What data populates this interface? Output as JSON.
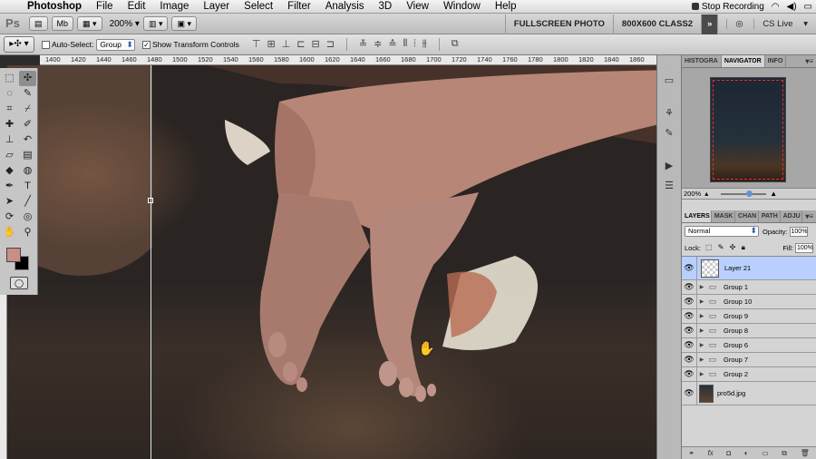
{
  "menubar": {
    "app_name": "Photoshop",
    "items": [
      "File",
      "Edit",
      "Image",
      "Layer",
      "Select",
      "Filter",
      "Analysis",
      "3D",
      "View",
      "Window",
      "Help"
    ],
    "stop_recording": "Stop Recording"
  },
  "appbar": {
    "ps_logo": "Ps",
    "mb_label": "Mb",
    "zoom": "200%",
    "workspaces": [
      "FULLSCREEN PHOTO",
      "800X600 CLASS2"
    ],
    "more": "»",
    "cs_live": "CS Live"
  },
  "options": {
    "auto_select_label": "Auto-Select:",
    "auto_select_checked": false,
    "auto_select_value": "Group",
    "show_transform_label": "Show Transform Controls",
    "show_transform_checked": true
  },
  "ruler": {
    "ticks": [
      "1400",
      "1420",
      "1440",
      "1460",
      "1480",
      "1500",
      "1520",
      "1540",
      "1560",
      "1580",
      "1600",
      "1620",
      "1640",
      "1660",
      "1680",
      "1700",
      "1720",
      "1740",
      "1760",
      "1780",
      "1800",
      "1820",
      "1840",
      "1860"
    ]
  },
  "colors": {
    "foreground": "#c98e86",
    "background": "#000000",
    "selected_layer": "#b9d0ff"
  },
  "navigator": {
    "tabs": [
      "HISTOGRA",
      "NAVIGATOR",
      "INFO"
    ],
    "active_tab": "NAVIGATOR",
    "zoom": "200%"
  },
  "layers_panel": {
    "tabs": [
      "LAYERS",
      "MASK",
      "CHAN",
      "PATH",
      "ADJU"
    ],
    "active_tab": "LAYERS",
    "blend_mode": "Normal",
    "opacity_label": "Opacity:",
    "opacity": "100%",
    "lock_label": "Lock:",
    "fill_label": "Fill:",
    "fill": "100%",
    "layers": [
      {
        "name": "Layer 21",
        "type": "layer",
        "selected": true
      },
      {
        "name": "Group 1",
        "type": "group"
      },
      {
        "name": "Group 10",
        "type": "group"
      },
      {
        "name": "Group 9",
        "type": "group"
      },
      {
        "name": "Group 8",
        "type": "group"
      },
      {
        "name": "Group 6",
        "type": "group"
      },
      {
        "name": "Group 7",
        "type": "group"
      },
      {
        "name": "Group 2",
        "type": "group"
      },
      {
        "name": "pro5d.jpg",
        "type": "background"
      }
    ],
    "footer_icons": [
      "link-icon",
      "fx-icon",
      "mask-icon",
      "adjustment-icon",
      "folder-icon",
      "new-layer-icon",
      "trash-icon"
    ]
  }
}
